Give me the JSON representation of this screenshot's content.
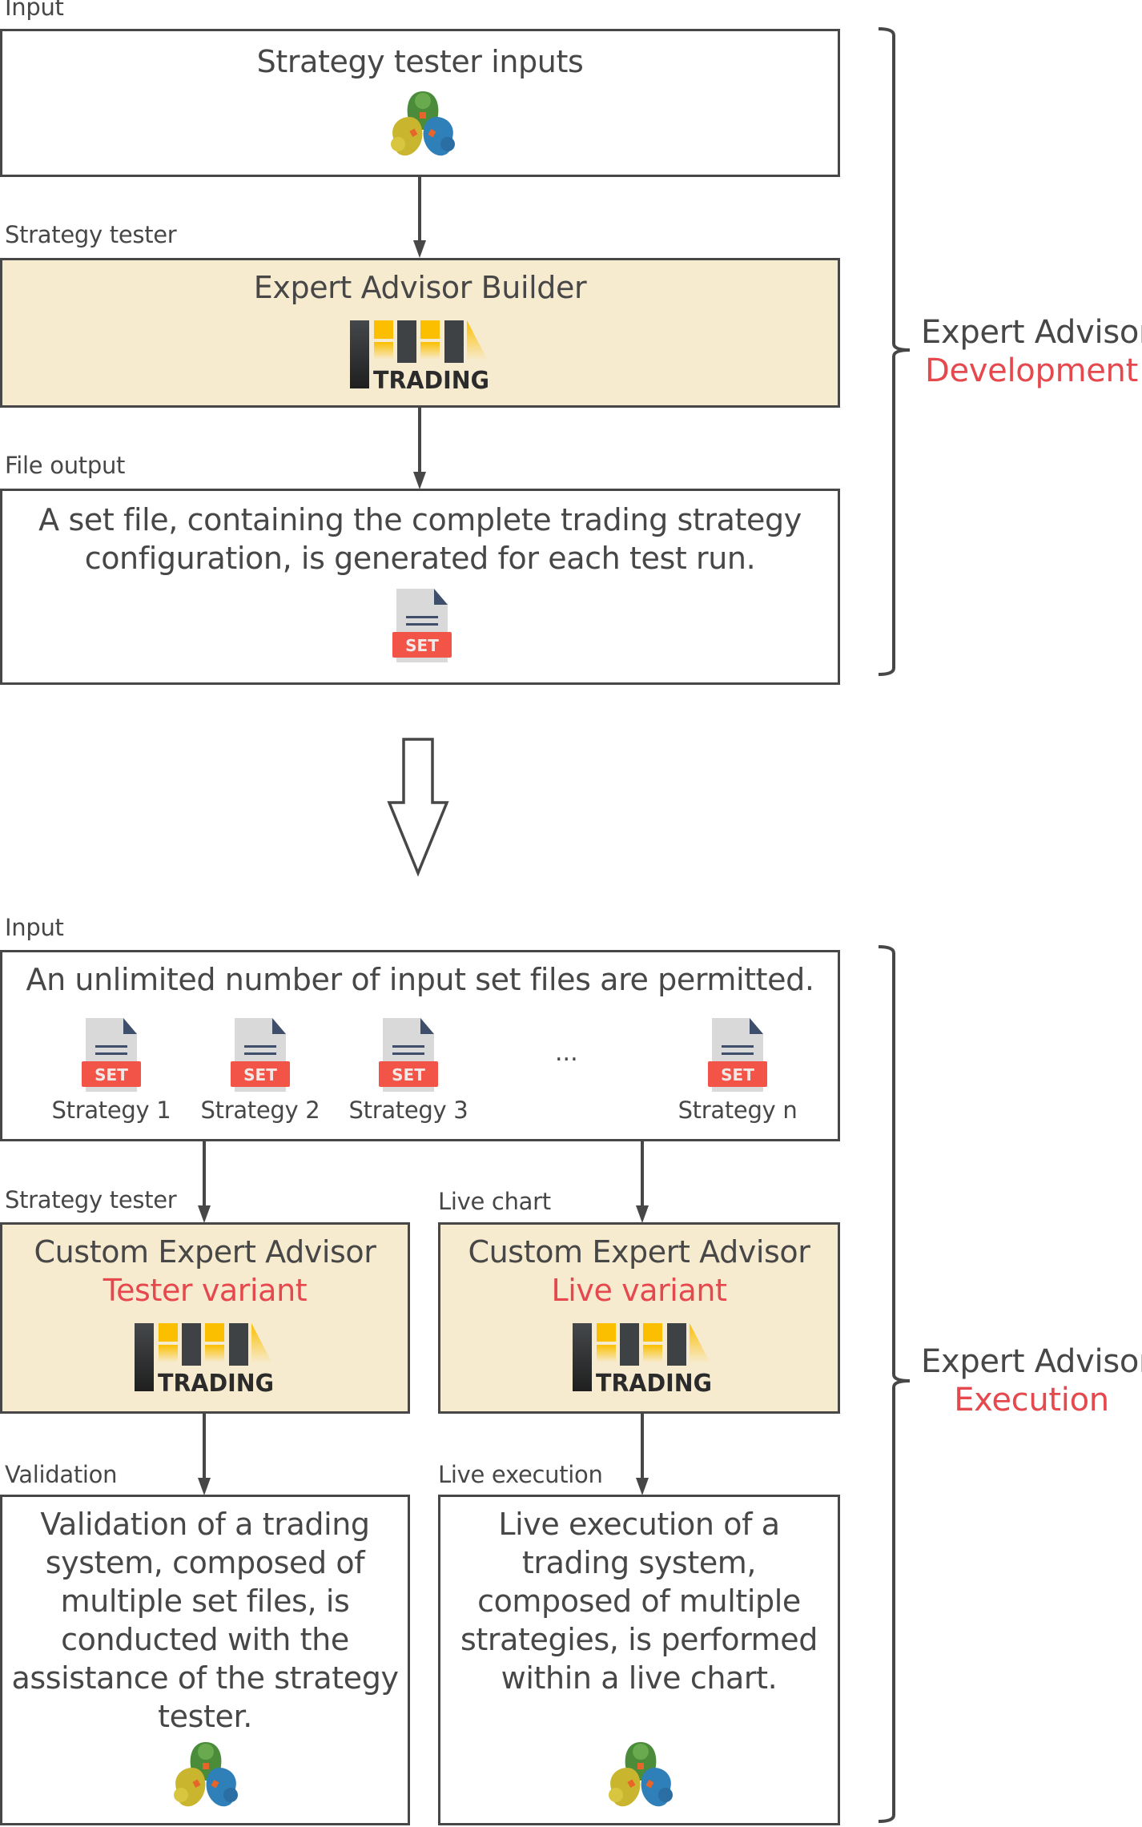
{
  "development": {
    "input_label": "Input",
    "input_box": {
      "title": "Strategy tester inputs",
      "icon": "metatrader-icon"
    },
    "tester_label": "Strategy tester",
    "builder_box": {
      "title": "Expert Advisor Builder",
      "icon": "trading-logo-icon",
      "logo_text": "TRADING"
    },
    "output_label": "File output",
    "output_box": {
      "lines": [
        "A set file, containing the complete trading strategy",
        "configuration, is generated for each test run."
      ],
      "icon": "set-file-icon",
      "icon_badge": "SET"
    },
    "bracket": {
      "line1": "Expert Advisor",
      "line2": "Development"
    }
  },
  "transition_arrow": {
    "icon": "down-arrow-icon"
  },
  "execution": {
    "input_label": "Input",
    "input_box": {
      "title": "An unlimited number of input set files are permitted.",
      "set_files": [
        {
          "label": "Strategy 1",
          "badge": "SET"
        },
        {
          "label": "Strategy 2",
          "badge": "SET"
        },
        {
          "label": "Strategy 3",
          "badge": "SET"
        },
        {
          "label": "Strategy n",
          "badge": "SET"
        }
      ],
      "ellipsis": "..."
    },
    "tester_branch": {
      "label": "Strategy tester",
      "box_title": "Custom Expert Advisor",
      "box_variant": "Tester variant",
      "logo_text": "TRADING",
      "result_label": "Validation",
      "result_lines": [
        "Validation of a trading",
        "system, composed of",
        "multiple set files, is",
        "conducted with the",
        "assistance of the strategy",
        "tester."
      ]
    },
    "live_branch": {
      "label": "Live chart",
      "box_title": "Custom Expert Advisor",
      "box_variant": "Live variant",
      "logo_text": "TRADING",
      "result_label": "Live execution",
      "result_lines": [
        "Live execution of a",
        "trading system,",
        "composed of multiple",
        "strategies, is performed",
        "within a live chart."
      ]
    },
    "bracket": {
      "line1": "Expert Advisor",
      "line2": "Execution"
    }
  },
  "colors": {
    "stroke": "#474747",
    "accent_red": "#e5484d",
    "box_tan": "#f7ebcf",
    "set_red": "#f25447",
    "logo_yellow": "#fbbf00",
    "logo_dark": "#3f4245"
  }
}
